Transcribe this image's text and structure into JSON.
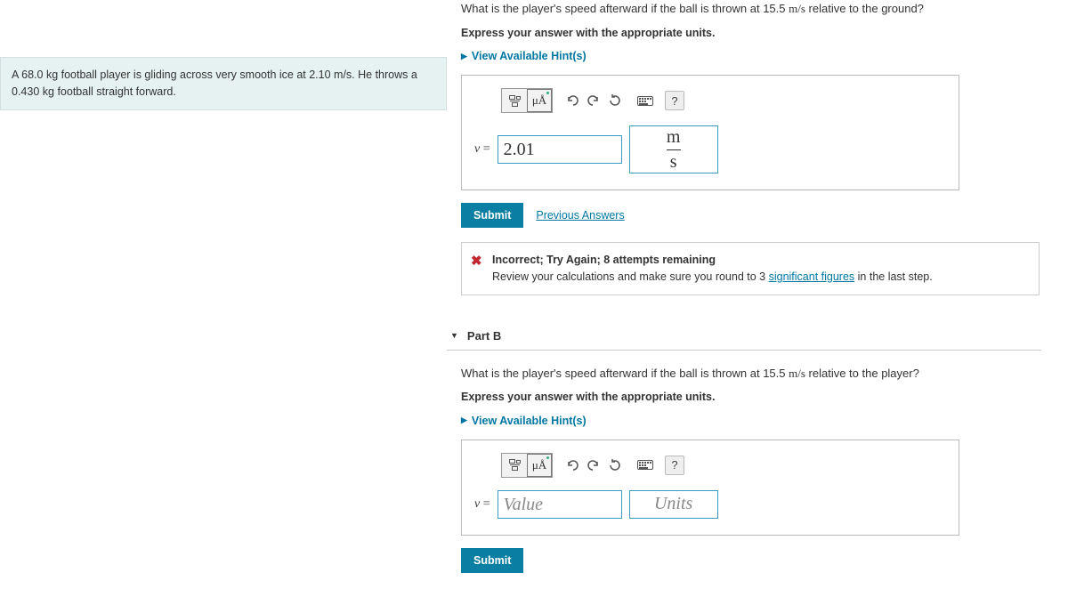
{
  "problem": {
    "text_before_units1": "A 68.0 ",
    "units1": "kg",
    "text_mid1": " football player is gliding across very smooth ice at 2.10 ",
    "units2": "m/s",
    "text_mid2": ". He throws a 0.430 ",
    "units3": "kg",
    "text_after": " football straight forward."
  },
  "partA": {
    "question_before": "What is the player's speed afterward if the ball is thrown at 15.5 ",
    "question_units": "m/s",
    "question_after": " relative to the ground?",
    "instruction": "Express your answer with the appropriate units.",
    "hints_label": "View Available Hint(s)",
    "var_label": "v =",
    "value": "2.01",
    "unit_num": "m",
    "unit_den": "s",
    "submit_label": "Submit",
    "prev_label": "Previous Answers",
    "special_btn": "μÅ",
    "feedback_heading": "Incorrect; Try Again; 8 attempts remaining",
    "feedback_body_before": "Review your calculations and make sure you round to 3 ",
    "feedback_link": "significant figures",
    "feedback_body_after": " in the last step."
  },
  "partB": {
    "header": "Part B",
    "question_before": "What is the player's speed afterward if the ball is thrown at 15.5 ",
    "question_units": "m/s",
    "question_after": " relative to the player?",
    "instruction": "Express your answer with the appropriate units.",
    "hints_label": "View Available Hint(s)",
    "var_label": "v =",
    "value_placeholder": "Value",
    "units_placeholder": "Units",
    "special_btn": "μÅ",
    "submit_label": "Submit"
  }
}
